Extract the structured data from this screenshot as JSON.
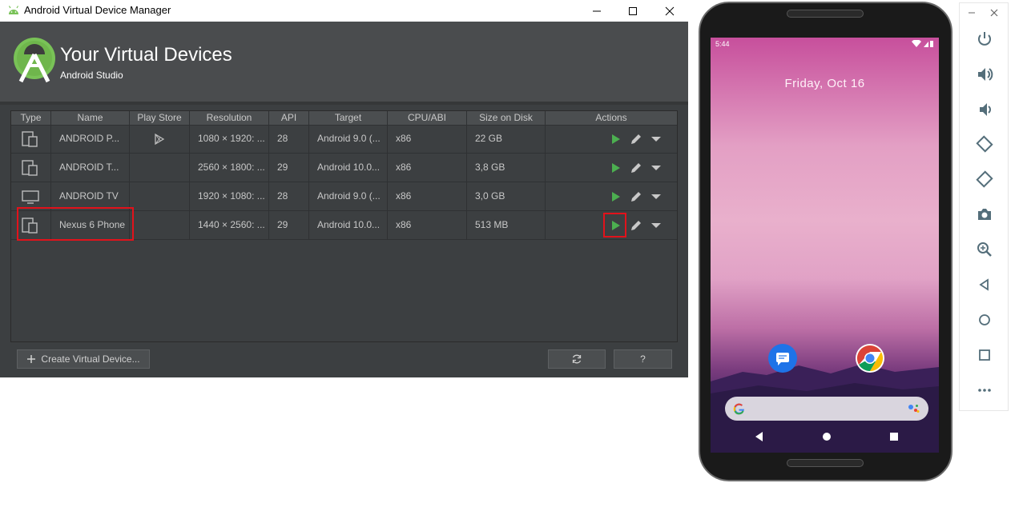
{
  "window": {
    "title": "Android Virtual Device Manager"
  },
  "header": {
    "title": "Your Virtual Devices",
    "subtitle": "Android Studio"
  },
  "table": {
    "columns": [
      "Type",
      "Name",
      "Play Store",
      "Resolution",
      "API",
      "Target",
      "CPU/ABI",
      "Size on Disk",
      "Actions"
    ],
    "rows": [
      {
        "type_icon": "phone-tablet-icon",
        "name": "ANDROID P...",
        "play_store": true,
        "resolution": "1080 × 1920: ...",
        "api": "28",
        "target": "Android 9.0 (...",
        "cpu": "x86",
        "size": "22 GB"
      },
      {
        "type_icon": "phone-tablet-icon",
        "name": "ANDROID T...",
        "play_store": false,
        "resolution": "2560 × 1800: ...",
        "api": "29",
        "target": "Android 10.0...",
        "cpu": "x86",
        "size": "3,8 GB"
      },
      {
        "type_icon": "tv-icon",
        "name": "ANDROID TV",
        "play_store": false,
        "resolution": "1920 × 1080: ...",
        "api": "28",
        "target": "Android 9.0 (...",
        "cpu": "x86",
        "size": "3,0 GB"
      },
      {
        "type_icon": "phone-tablet-icon",
        "name": "Nexus 6 Phone",
        "play_store": false,
        "resolution": "1440 × 2560: ...",
        "api": "29",
        "target": "Android 10.0...",
        "cpu": "x86",
        "size": "513 MB"
      }
    ]
  },
  "buttons": {
    "create": "Create Virtual Device...",
    "refresh_icon": "refresh-icon",
    "help": "?"
  },
  "phone": {
    "time": "5:44",
    "date": "Friday, Oct 16",
    "apps": [
      "messages-icon",
      "chrome-icon"
    ]
  },
  "toolbar": {
    "icons": [
      "power-icon",
      "volume-up-icon",
      "volume-down-icon",
      "rotate-left-icon",
      "rotate-right-icon",
      "camera-icon",
      "zoom-icon",
      "back-icon",
      "home-icon",
      "overview-icon",
      "more-icon"
    ]
  },
  "colors": {
    "accent_red": "#e2121b",
    "play_green": "#4caf50",
    "dark_bg": "#3c3f41"
  }
}
